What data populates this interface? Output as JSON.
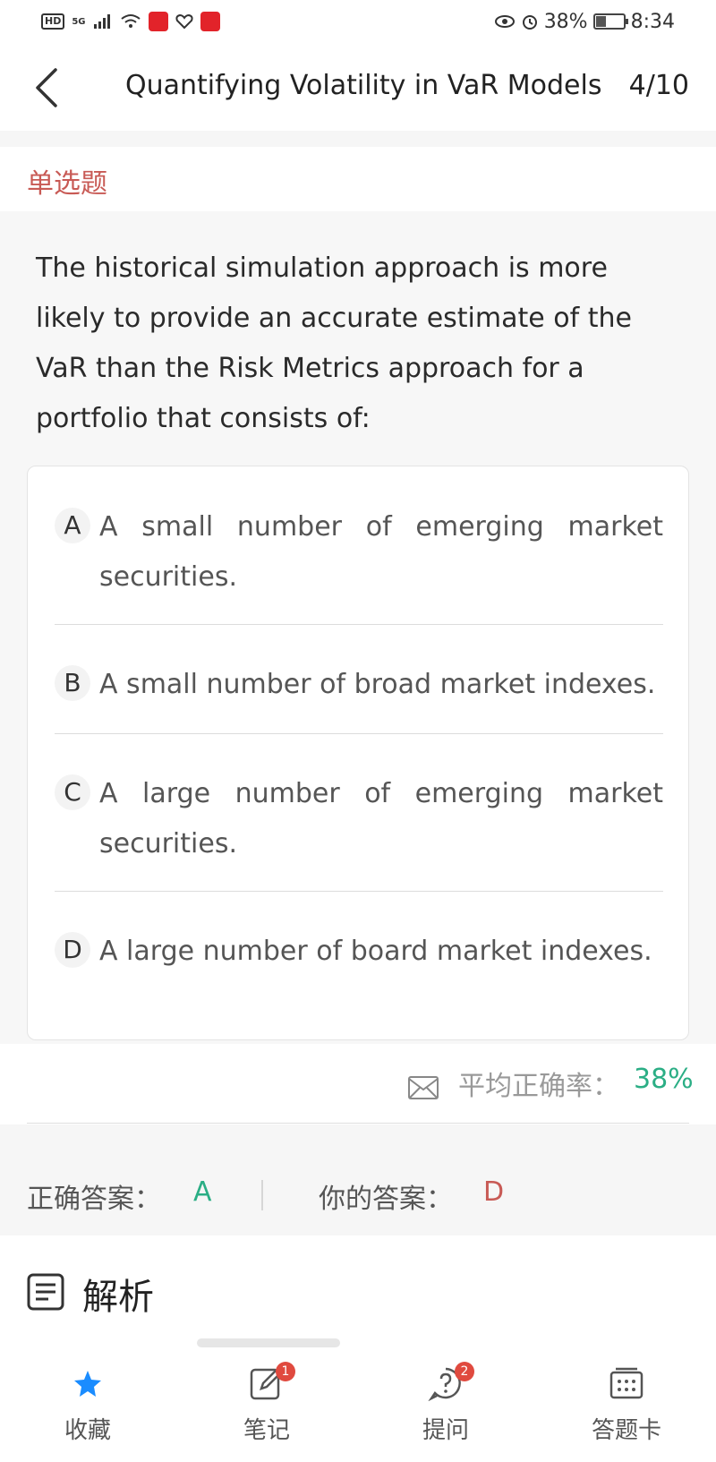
{
  "status_bar": {
    "hd": "HD",
    "network": "5G",
    "alarm_battery": "38%",
    "time": "8:34",
    "battery_level": 0.38
  },
  "header": {
    "title": "Quantifying Volatility in VaR Models",
    "page": "4/10"
  },
  "question": {
    "type": "单选题",
    "text": "The historical simulation approach is more likely to provide an accurate estimate of the VaR than the Risk Metrics approach for a portfolio that consists of:",
    "options": [
      {
        "letter": "A",
        "text": "A small number of emerging market securities."
      },
      {
        "letter": "B",
        "text": "A small number of broad market indexes."
      },
      {
        "letter": "C",
        "text": "A large number of emerging market securities."
      },
      {
        "letter": "D",
        "text": "A large number of board market indexes."
      }
    ]
  },
  "stats": {
    "avg_label": "平均正确率：",
    "avg_value": "38%"
  },
  "answers": {
    "correct_label": "正确答案：",
    "correct_value": "A",
    "yours_label": "你的答案：",
    "yours_value": "D"
  },
  "analysis": {
    "title": "解析"
  },
  "tabbar": {
    "items": [
      {
        "label": "收藏",
        "icon": "star-icon"
      },
      {
        "label": "笔记",
        "icon": "note-icon",
        "badge": "1"
      },
      {
        "label": "提问",
        "icon": "question-icon",
        "badge": "2"
      },
      {
        "label": "答题卡",
        "icon": "answer-card-icon"
      }
    ]
  },
  "colors": {
    "accent_red": "#c85a55",
    "accent_green": "#2bae85",
    "star_blue": "#1a8cff",
    "badge_red": "#e04a3f"
  }
}
